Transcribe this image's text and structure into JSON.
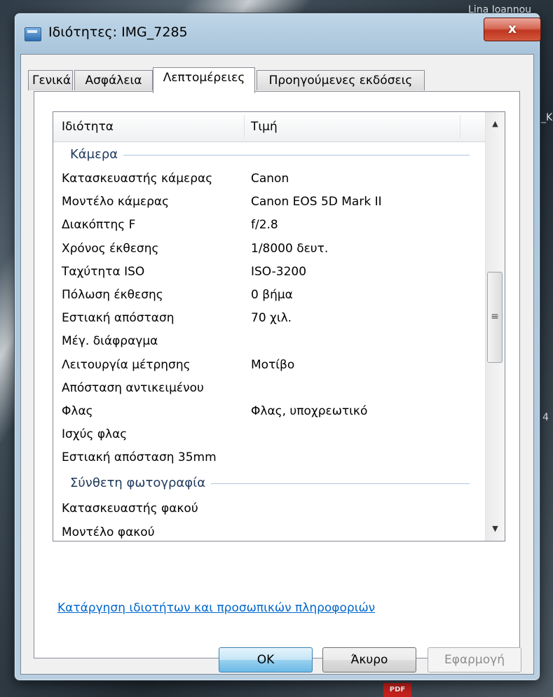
{
  "window": {
    "title": "Ιδιότητες: IMG_7285",
    "close_label": "x"
  },
  "background": {
    "top_right_text": "Lina Ioannou",
    "side_right_letter": "_K",
    "side_right_digit": "4",
    "taskbar_pdf": "PDF"
  },
  "tabs": [
    {
      "label": "Γενικά"
    },
    {
      "label": "Ασφάλεια"
    },
    {
      "label": "Λεπτομέρειες"
    },
    {
      "label": "Προηγούμενες εκδόσεις"
    }
  ],
  "columns": {
    "property": "Ιδιότητα",
    "value": "Τιμή"
  },
  "groups": {
    "camera": "Κάμερα",
    "composite": "Σύνθετη φωτογραφία"
  },
  "camera_rows": [
    {
      "k": "Κατασκευαστής κάμερας",
      "v": "Canon"
    },
    {
      "k": "Μοντέλο κάμερας",
      "v": "Canon EOS 5D Mark II"
    },
    {
      "k": "Διακόπτης F",
      "v": "f/2.8"
    },
    {
      "k": "Χρόνος έκθεσης",
      "v": "1/8000 δευτ."
    },
    {
      "k": "Ταχύτητα ISO",
      "v": "ISO-3200"
    },
    {
      "k": "Πόλωση έκθεσης",
      "v": "0 βήμα"
    },
    {
      "k": "Εστιακή απόσταση",
      "v": "70 χιλ."
    },
    {
      "k": "Μέγ. διάφραγμα",
      "v": ""
    },
    {
      "k": "Λειτουργία μέτρησης",
      "v": "Μοτίβο"
    },
    {
      "k": "Απόσταση αντικειμένου",
      "v": ""
    },
    {
      "k": "Φλας",
      "v": "Φλας, υποχρεωτικό"
    },
    {
      "k": "Ισχύς φλας",
      "v": ""
    },
    {
      "k": "Εστιακή απόσταση 35mm",
      "v": ""
    }
  ],
  "composite_rows": [
    {
      "k": "Κατασκευαστής φακού",
      "v": ""
    },
    {
      "k": "Μοντέλο φακού",
      "v": ""
    }
  ],
  "remove_link": "Κατάργηση ιδιοτήτων και προσωπικών πληροφοριών",
  "buttons": {
    "ok": "OK",
    "cancel": "Άκυρο",
    "apply": "Εφαρμογή"
  }
}
